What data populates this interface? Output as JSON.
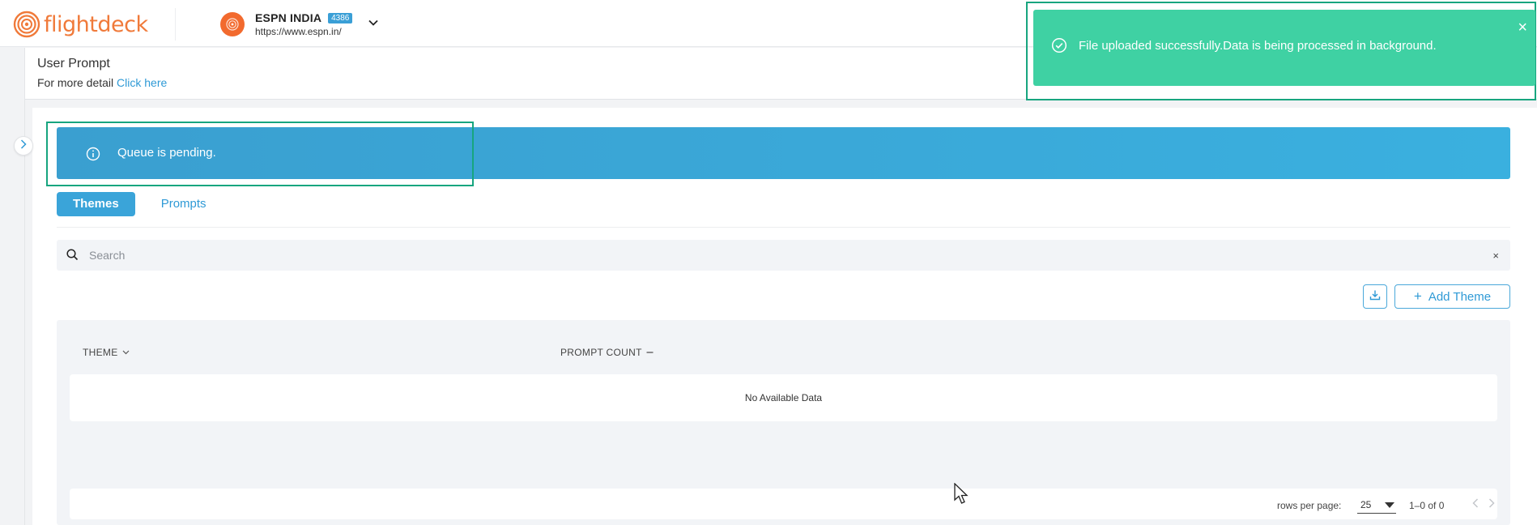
{
  "header": {
    "logo_text": "flightdeck",
    "site_name": "ESPN INDIA",
    "site_badge": "4386",
    "site_url": "https://www.espn.in/"
  },
  "subheader": {
    "title": "User Prompt",
    "detail_prefix": "For more detail",
    "detail_link": "Click here"
  },
  "banner": {
    "text": "Queue is pending."
  },
  "tabs": [
    {
      "label": "Themes",
      "active": true
    },
    {
      "label": "Prompts",
      "active": false
    }
  ],
  "search": {
    "placeholder": "Search",
    "clear": "×"
  },
  "actions": {
    "add_theme": "Add Theme"
  },
  "table": {
    "columns": [
      "THEME",
      "PROMPT COUNT"
    ],
    "empty_text": "No Available Data"
  },
  "pagination": {
    "rows_per_page_label": "rows per page:",
    "rows_per_page": "25",
    "range": "1–0 of 0"
  },
  "toast": {
    "message": "File uploaded successfully.Data is being processed in background.",
    "close": "×",
    "color": "#3fd1a3"
  },
  "colors": {
    "accent": "#3aa4d9",
    "brand": "#f07a3a",
    "highlight": "#17a57f"
  }
}
